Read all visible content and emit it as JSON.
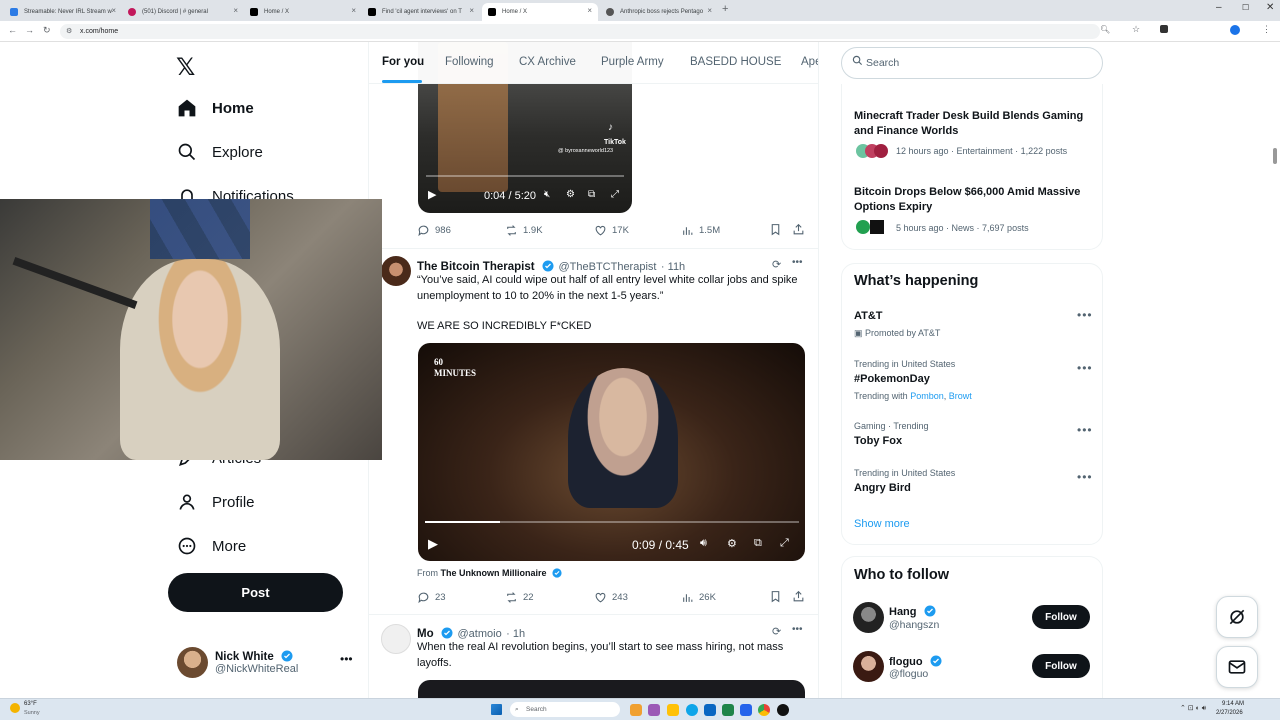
{
  "browser": {
    "tabs": [
      {
        "title": "Streamable: Never IRL Stream w",
        "icon_color": "#2c7be5"
      },
      {
        "title": "(501) Discord | # general",
        "icon_color": "#c2185b"
      },
      {
        "title": "Home / X",
        "icon_color": "#000000"
      },
      {
        "title": "Find 'cil agent interviews' on T",
        "icon_color": "#000000"
      },
      {
        "title": "Home / X",
        "icon_color": "#000000",
        "active": true
      },
      {
        "title": "Anthropic boss rejects Pentago",
        "icon_color": "#555555"
      }
    ],
    "url": "x.com/home"
  },
  "nav": {
    "items": [
      {
        "label": "Home",
        "icon": "home-icon",
        "bold": true
      },
      {
        "label": "Explore",
        "icon": "search-icon"
      },
      {
        "label": "Notifications",
        "icon": "bell-icon"
      },
      {
        "label": "Articles",
        "icon": "articles-icon"
      },
      {
        "label": "Profile",
        "icon": "profile-icon"
      },
      {
        "label": "More",
        "icon": "more-circle-icon"
      }
    ],
    "post_label": "Post",
    "account": {
      "name": "Nick White",
      "handle": "@NickWhiteReal"
    }
  },
  "feed": {
    "tabs": [
      "For you",
      "Following",
      "CX Archive",
      "Purple Army",
      "BASEDD HOUSE",
      "Ape"
    ],
    "first_video": {
      "time": "0:04 / 5:20",
      "watermark": "TikTok",
      "watermark_handle": "@ byroxanneworld123"
    },
    "first_actions": {
      "replies": "986",
      "reposts": "1.9K",
      "likes": "17K",
      "views": "1.5M"
    },
    "tweet1": {
      "name": "The Bitcoin Therapist",
      "handle": "@TheBTCTherapist",
      "time": "· 11h",
      "text1": "“You’ve said, AI could wipe out half of all entry level white collar jobs and spike unemployment to 10 to 20% in the next 1-5 years.”",
      "text2": "WE ARE SO INCREDIBLY F*CKED",
      "video_time": "0:09 / 0:45",
      "video_logo": "60 MINUTES",
      "from_prefix": "From",
      "from_name": "The Unknown Millionaire",
      "replies": "23",
      "reposts": "22",
      "likes": "243",
      "views": "26K"
    },
    "tweet2": {
      "name": "Mo",
      "handle": "@atmoio",
      "time": "· 1h",
      "text": "When the real AI revolution begins, you’ll start to see mass hiring, not mass layoffs."
    }
  },
  "sidebar": {
    "search_placeholder": "Search",
    "trending_news": [
      {
        "title": "Minecraft Trader Desk Build Blends Gaming and Finance Worlds",
        "meta": "12 hours ago · Entertainment · 1,222 posts"
      },
      {
        "title": "Bitcoin Drops Below $66,000 Amid Massive Options Expiry",
        "meta": "5 hours ago · News · 7,697 posts"
      }
    ],
    "whats_happening_title": "What’s happening",
    "trends": [
      {
        "context": "Promoted by AT&T",
        "name": "AT&T",
        "promoted": true
      },
      {
        "context": "Trending in United States",
        "name": "#PokemonDay",
        "with_prefix": "Trending with",
        "with": [
          "Pombon",
          "Browt"
        ]
      },
      {
        "context": "Gaming · Trending",
        "name": "Toby Fox"
      },
      {
        "context": "Trending in United States",
        "name": "Angry Bird"
      }
    ],
    "show_more": "Show more",
    "who_to_follow_title": "Who to follow",
    "follow": [
      {
        "name": "Hang",
        "handle": "@hangszn",
        "button": "Follow"
      },
      {
        "name": "floguo",
        "handle": "@floguo",
        "button": "Follow"
      }
    ]
  },
  "taskbar": {
    "weather_temp": "63°F",
    "weather_desc": "Sunny",
    "search": "Search",
    "time": "9:14 AM",
    "date": "2/27/2026"
  },
  "colors": {
    "accent": "#1d9bf0",
    "text": "#0f1419",
    "muted": "#536471"
  }
}
